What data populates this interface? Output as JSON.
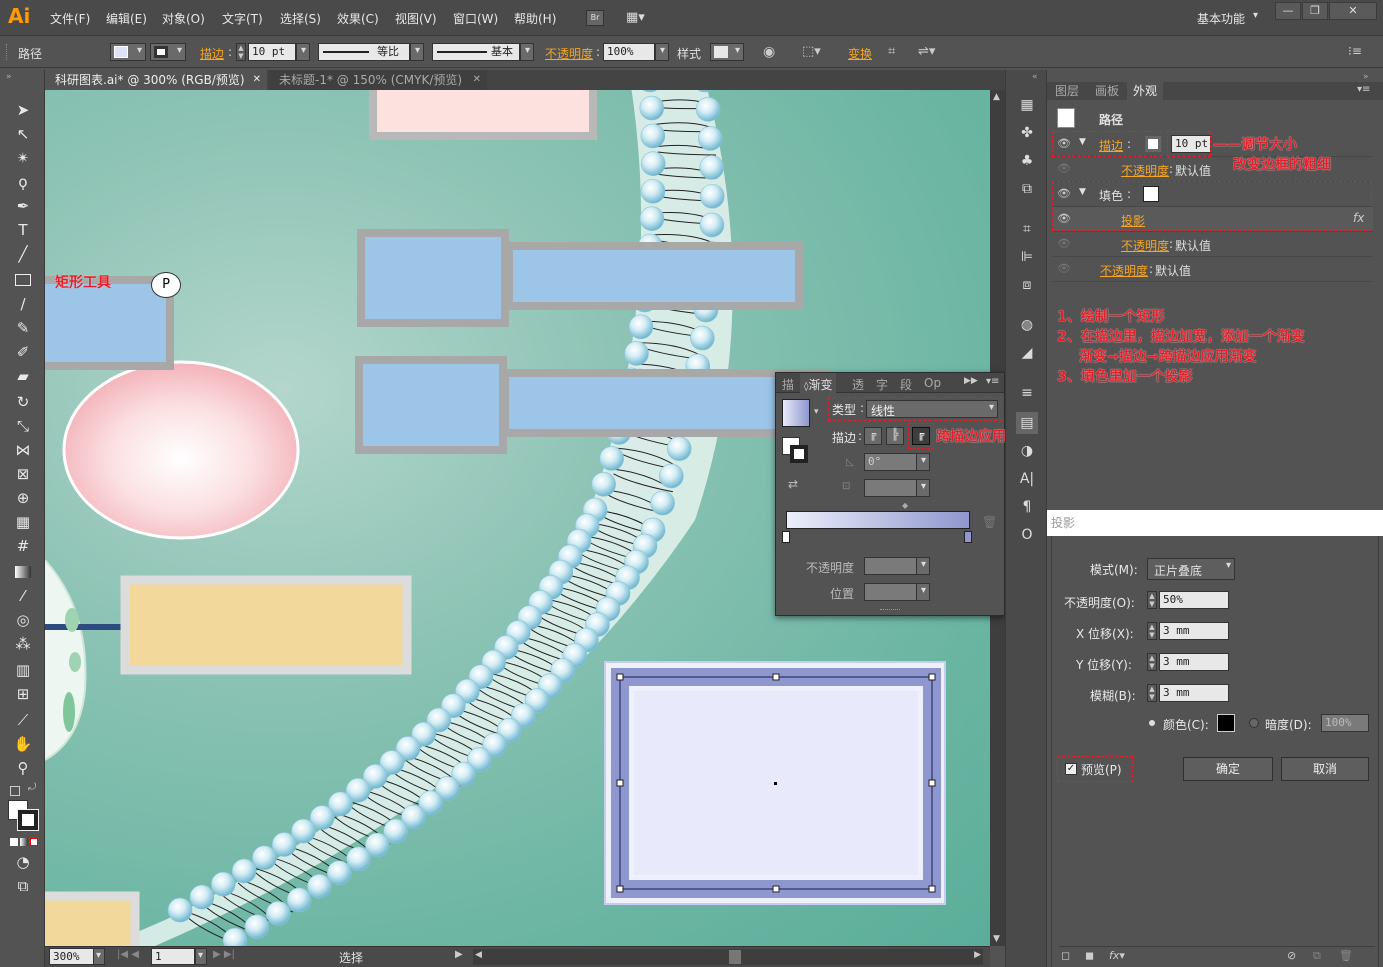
{
  "app": {
    "logo": "Ai",
    "workspace": "基本功能"
  },
  "menu": [
    "文件(F)",
    "编辑(E)",
    "对象(O)",
    "文字(T)",
    "选择(S)",
    "效果(C)",
    "视图(V)",
    "窗口(W)",
    "帮助(H)"
  ],
  "bridge_label": "Br",
  "window": {
    "minimize": "—",
    "restore": "❐",
    "close": "✕"
  },
  "control": {
    "object_type": "路径",
    "stroke_label": "描边",
    "stroke_weight": "10 pt",
    "profile": "等比",
    "brush": "基本",
    "opacity_label": "不透明度",
    "opacity": "100%",
    "style_label": "样式",
    "transform_label": "变换"
  },
  "tabs": [
    {
      "label": "科研图表.ai* @ 300% (RGB/预览)",
      "close": "✕"
    },
    {
      "label": "未标题-1* @ 150% (CMYK/预览)",
      "close": "✕"
    }
  ],
  "status": {
    "zoom": "300%",
    "page": "1",
    "tool_status": "选择"
  },
  "appearance": {
    "tabs": [
      "图层",
      "画板",
      "外观"
    ],
    "object": "路径",
    "rows": [
      {
        "label": "描边",
        "value": "10 pt"
      },
      {
        "label": "不透明度",
        "value": "默认值"
      },
      {
        "label": "填色",
        "value": ""
      },
      {
        "label": "投影",
        "value": ""
      },
      {
        "label": "不透明度",
        "value": "默认值"
      },
      {
        "label": "不透明度",
        "value": "默认值"
      }
    ],
    "fx": "fx"
  },
  "gradient_panel": {
    "tabs": [
      "描",
      "渐变",
      "透",
      "字",
      "段",
      "Op"
    ],
    "type_label": "类型",
    "type_value": "线性",
    "stroke_label": "描边",
    "angle": "0°",
    "opacity_label": "不透明度",
    "position_label": "位置"
  },
  "shadow_dialog": {
    "title": "投影",
    "mode_label": "模式(M):",
    "mode_value": "正片叠底",
    "opacity_label": "不透明度(O):",
    "opacity_value": "50%",
    "x_label": "X 位移(X):",
    "x_value": "3 mm",
    "y_label": "Y 位移(Y):",
    "y_value": "3 mm",
    "blur_label": "模糊(B):",
    "blur_value": "3 mm",
    "color_label": "颜色(C):",
    "darkness_label": "暗度(D):",
    "darkness_value": "100%",
    "preview_label": "预览(P)",
    "ok": "确定",
    "cancel": "取消"
  },
  "annotations": {
    "rect_tool": "矩形工具",
    "shortcut": "P",
    "adjust_size": "——调节大小",
    "change_border": "改变边框的粗细",
    "steps": [
      "1、绘制一个矩形",
      "2、在描边里，描边加宽，添加一个渐变",
      "渐变→描边→跨描边应用渐变",
      "3、填色里加一个投影"
    ],
    "across_stroke": "跨描边应用渐变"
  }
}
